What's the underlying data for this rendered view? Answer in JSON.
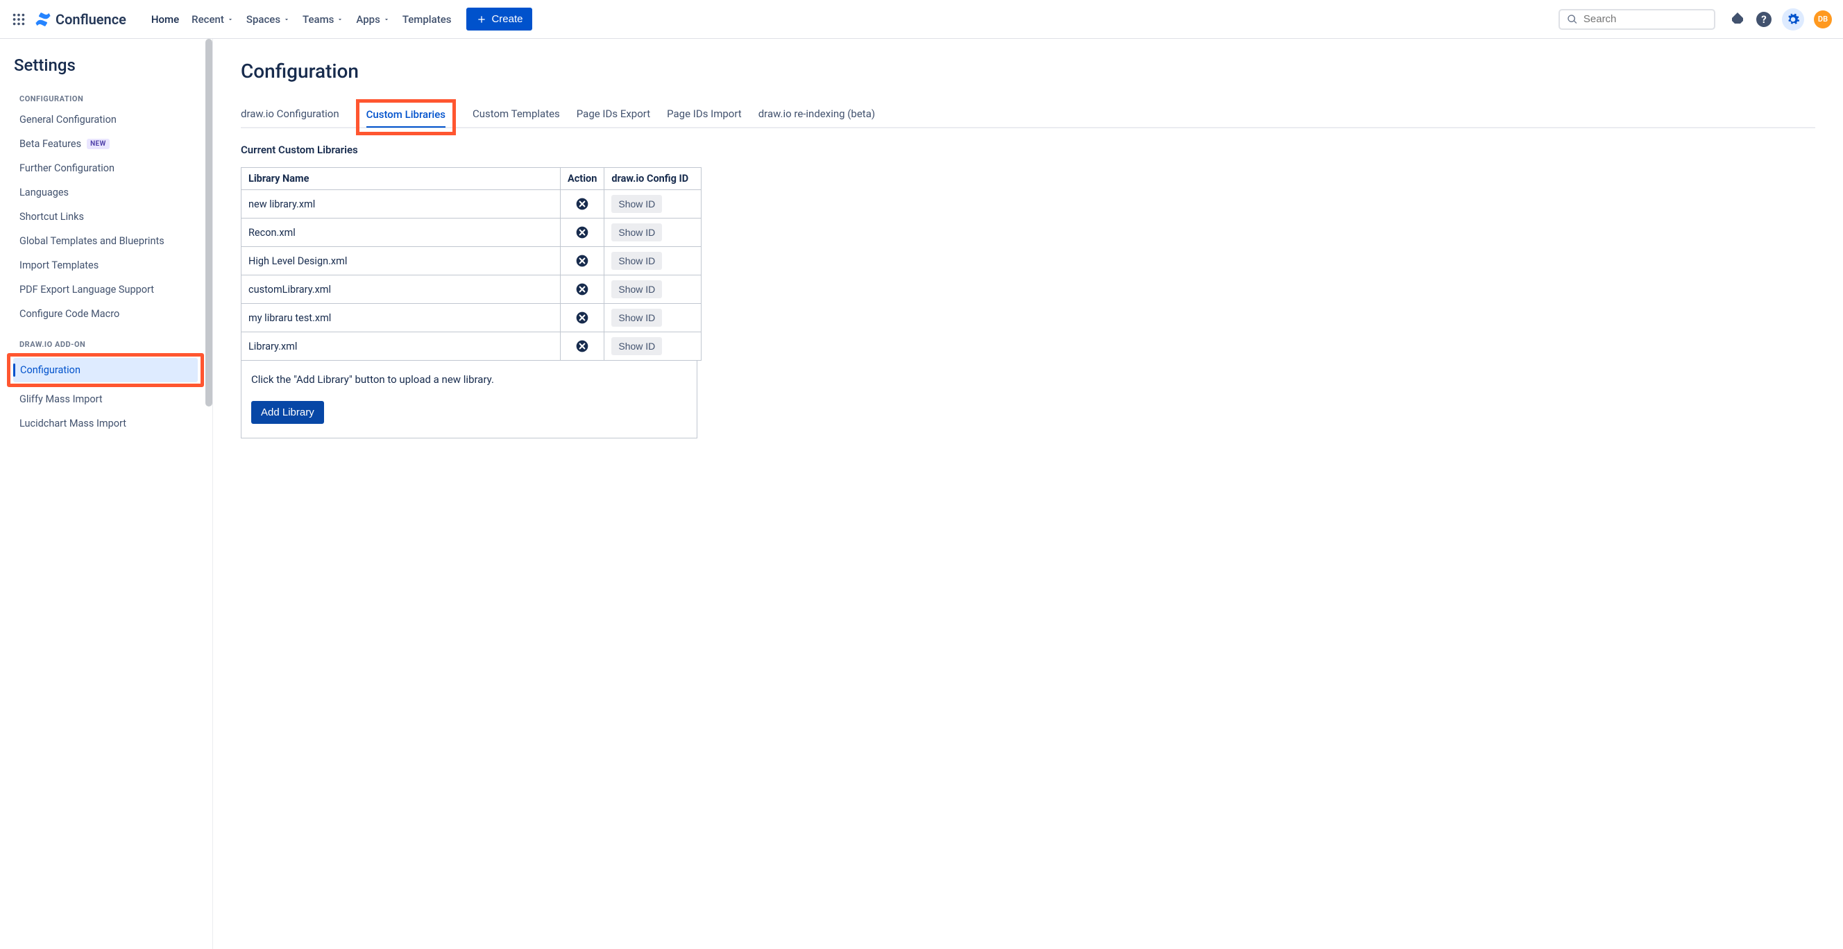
{
  "topbar": {
    "product_name": "Confluence",
    "nav": [
      "Home",
      "Recent",
      "Spaces",
      "Teams",
      "Apps",
      "Templates"
    ],
    "create_label": "Create",
    "search_placeholder": "Search",
    "avatar_initials": "DB"
  },
  "sidebar": {
    "title": "Settings",
    "sections": [
      {
        "heading": "CONFIGURATION",
        "items": [
          {
            "label": "General Configuration"
          },
          {
            "label": "Beta Features",
            "badge": "NEW"
          },
          {
            "label": "Further Configuration"
          },
          {
            "label": "Languages"
          },
          {
            "label": "Shortcut Links"
          },
          {
            "label": "Global Templates and Blueprints"
          },
          {
            "label": "Import Templates"
          },
          {
            "label": "PDF Export Language Support"
          },
          {
            "label": "Configure Code Macro"
          }
        ]
      },
      {
        "heading": "DRAW.IO ADD-ON",
        "items": [
          {
            "label": "Configuration",
            "active": true,
            "highlighted": true
          },
          {
            "label": "Gliffy Mass Import"
          },
          {
            "label": "Lucidchart Mass Import"
          }
        ]
      }
    ]
  },
  "content": {
    "title": "Configuration",
    "tabs": [
      {
        "label": "draw.io Configuration"
      },
      {
        "label": "Custom Libraries",
        "active": true,
        "highlighted": true
      },
      {
        "label": "Custom Templates"
      },
      {
        "label": "Page IDs Export"
      },
      {
        "label": "Page IDs Import"
      },
      {
        "label": "draw.io re-indexing (beta)"
      }
    ],
    "section_heading": "Current Custom Libraries",
    "table": {
      "headers": [
        "Library Name",
        "Action",
        "draw.io Config ID"
      ],
      "rows": [
        {
          "name": "new library.xml"
        },
        {
          "name": "Recon.xml"
        },
        {
          "name": "High Level Design.xml"
        },
        {
          "name": "customLibrary.xml"
        },
        {
          "name": "my libraru test.xml"
        },
        {
          "name": "Library.xml"
        }
      ],
      "show_id_label": "Show ID"
    },
    "hint_text": "Click the \"Add Library\" button to upload a new library.",
    "add_button_label": "Add Library"
  }
}
